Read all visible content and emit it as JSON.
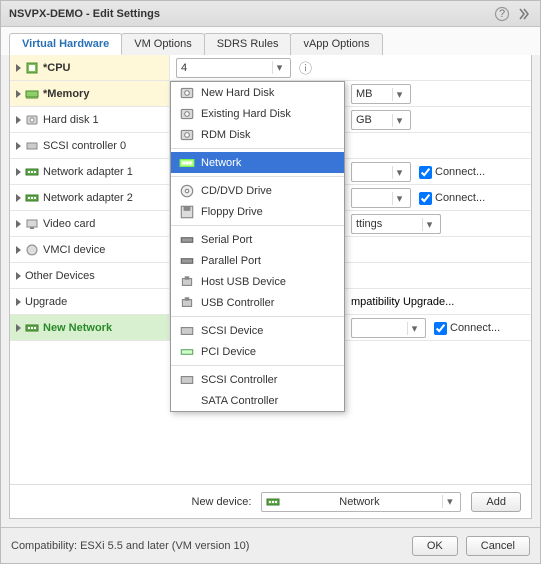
{
  "window": {
    "title": "NSVPX-DEMO - Edit Settings"
  },
  "tabs": [
    "Virtual Hardware",
    "VM Options",
    "SDRS Rules",
    "vApp Options"
  ],
  "rows": {
    "cpu": {
      "label": "*CPU",
      "value": "4"
    },
    "memory": {
      "label": "*Memory",
      "unit": "MB"
    },
    "hd1": {
      "label": "Hard disk 1",
      "unit": "GB"
    },
    "scsi": {
      "label": "SCSI controller 0"
    },
    "net1": {
      "label": "Network adapter 1",
      "connect": "Connect..."
    },
    "net2": {
      "label": "Network adapter 2",
      "connect": "Connect..."
    },
    "video": {
      "label": "Video card",
      "setting": "ttings"
    },
    "vmci": {
      "label": "VMCI device"
    },
    "other": {
      "label": "Other Devices"
    },
    "upgrade": {
      "label": "Upgrade",
      "setting": "mpatibility Upgrade..."
    },
    "newnet": {
      "label": "New Network",
      "connect": "Connect..."
    }
  },
  "menu": {
    "items": [
      "New Hard Disk",
      "Existing Hard Disk",
      "RDM Disk",
      "---",
      "Network",
      "---",
      "CD/DVD Drive",
      "Floppy Drive",
      "---",
      "Serial Port",
      "Parallel Port",
      "Host USB Device",
      "USB Controller",
      "---",
      "SCSI Device",
      "PCI Device",
      "---",
      "SCSI Controller",
      "SATA Controller"
    ],
    "selected": "Network"
  },
  "new_device": {
    "label": "New device:",
    "value": "Network",
    "add": "Add"
  },
  "footer": {
    "compat": "Compatibility: ESXi 5.5 and later (VM version 10)",
    "ok": "OK",
    "cancel": "Cancel"
  }
}
